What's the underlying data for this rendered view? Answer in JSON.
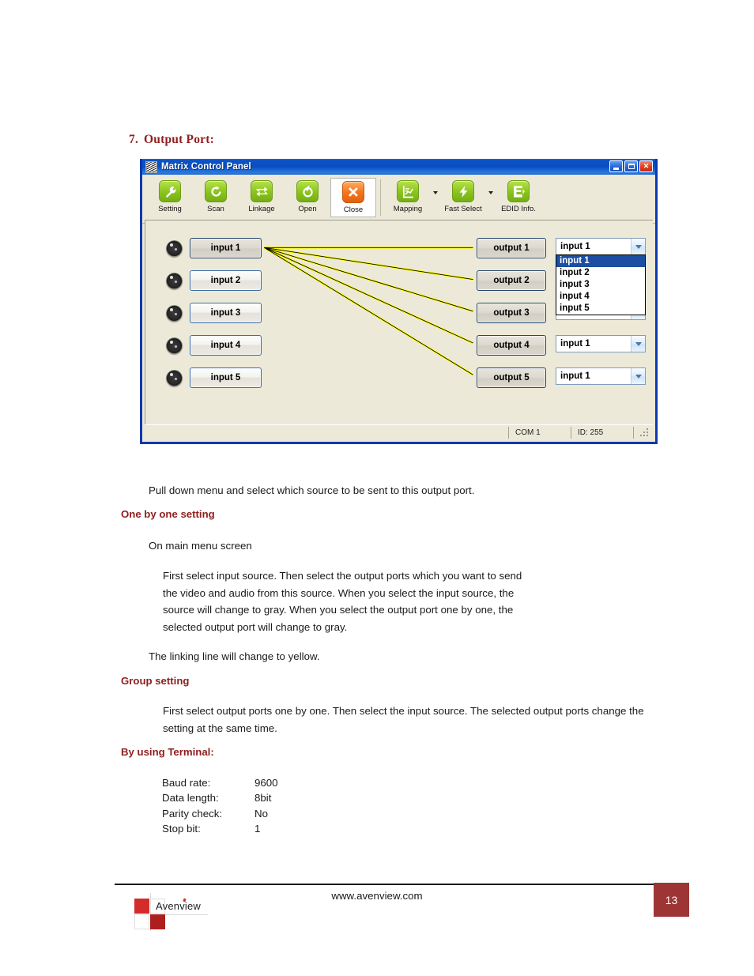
{
  "heading": {
    "number": "7.",
    "text": "Output Port:"
  },
  "window": {
    "title": "Matrix Control Panel",
    "title_icon": "matrix-icon",
    "controls": {
      "minimize": "minimize-button",
      "maximize": "maximize-button",
      "close": "close-button"
    },
    "toolbar": [
      {
        "label": "Setting",
        "icon": "wrench-icon",
        "color": "#8cc520",
        "framed": false
      },
      {
        "label": "Scan",
        "icon": "refresh-circle-icon",
        "color": "#8cc520",
        "framed": false
      },
      {
        "label": "Linkage",
        "icon": "link-sync-icon",
        "color": "#8cc520",
        "framed": false
      },
      {
        "label": "Open",
        "icon": "power-icon",
        "color": "#8cc520",
        "framed": false
      },
      {
        "label": "Close",
        "icon": "x-icon",
        "color": "#f5741c",
        "framed": true
      },
      {
        "label": "Mapping",
        "icon": "chart-map-icon",
        "color": "#8cc520",
        "framed": false
      },
      {
        "label": "Fast Select",
        "icon": "lightning-icon",
        "color": "#8cc520",
        "framed": false
      },
      {
        "label": "EDID Info.",
        "icon": "edid-icon",
        "color": "#8cc520",
        "framed": false
      }
    ],
    "inputs": [
      {
        "label": "input 1",
        "selected": true
      },
      {
        "label": "input 2",
        "selected": false
      },
      {
        "label": "input 3",
        "selected": false
      },
      {
        "label": "input 4",
        "selected": false
      },
      {
        "label": "input 5",
        "selected": false
      }
    ],
    "outputs": [
      {
        "label": "output 1",
        "selected": true
      },
      {
        "label": "output 2",
        "selected": true
      },
      {
        "label": "output 3",
        "selected": true
      },
      {
        "label": "output 4",
        "selected": true
      },
      {
        "label": "output 5",
        "selected": true
      }
    ],
    "combos": [
      {
        "value": "input 1",
        "open": true
      },
      {
        "value": "input 1",
        "open": false
      },
      {
        "value": "input 1",
        "open": false
      }
    ],
    "dropdown_options": [
      "input 1",
      "input 2",
      "input 3",
      "input 4",
      "input 5"
    ],
    "dropdown_selected": "input 1",
    "statusbar": {
      "com": "COM 1",
      "id": "ID: 255"
    },
    "colors": {
      "titlebar": "#0b52c8",
      "panel": "#ece9d8",
      "wire": "#ffff00",
      "accent_green": "#8cc520",
      "accent_orange": "#f5741c"
    }
  },
  "body": {
    "intro": "Pull down menu and select which source to be sent to this output port.",
    "section1_title": "One by one setting",
    "section1_sub": "On main menu screen",
    "section1_para": "First select input source. Then select the output ports which you want to send the video and audio from this source. When you select the input source, the source will change to gray. When you select the output port one by one, the selected output port will change to gray.",
    "section1_note": "The linking line will change to yellow.",
    "section2_title": "Group setting",
    "section2_para": "First select output ports one by one. Then select the input source. The selected output ports change the setting at the same time.",
    "section3_title": "By using Terminal:",
    "terminal": [
      {
        "key": "Baud rate:",
        "value": "9600"
      },
      {
        "key": "Data length:",
        "value": "8bit"
      },
      {
        "key": "Parity check:",
        "value": "No"
      },
      {
        "key": "Stop bit:",
        "value": "1"
      }
    ]
  },
  "footer": {
    "url": "www.avenview.com",
    "page_number": "13",
    "logo_text": "Avenview",
    "badge_color": "#9e3535"
  }
}
